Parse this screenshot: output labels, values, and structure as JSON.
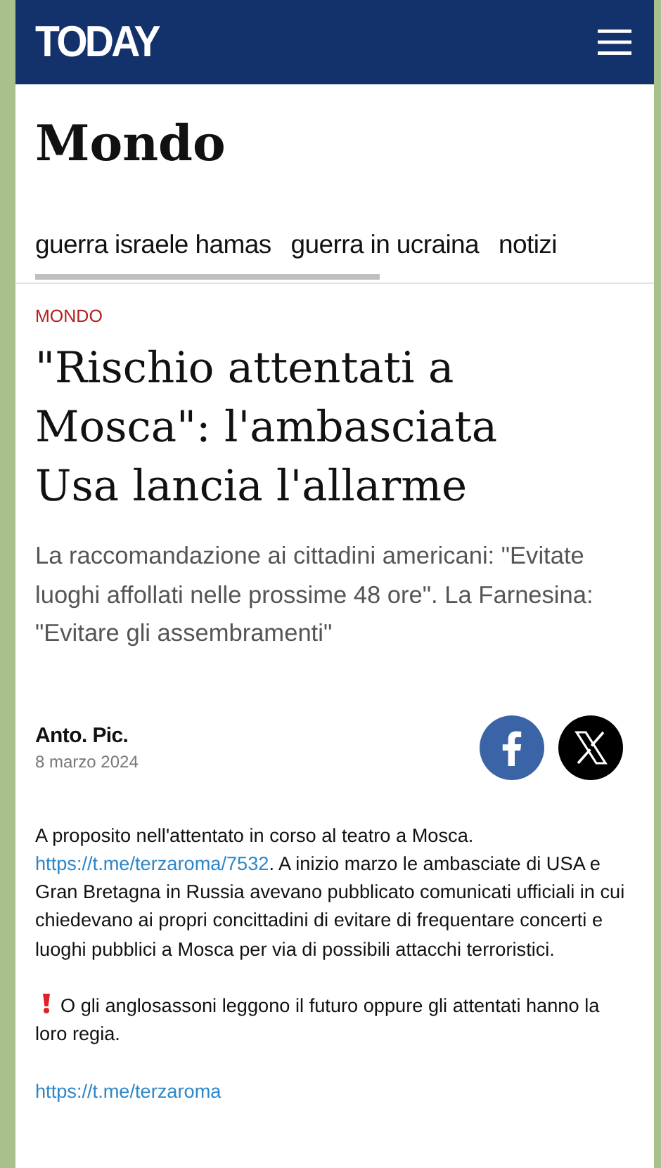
{
  "article": {
    "logo": "TODAY",
    "section_title": "Mondo",
    "tags": [
      {
        "label": "guerra israele hamas"
      },
      {
        "label": "guerra in ucraina"
      },
      {
        "label": "notizi"
      }
    ],
    "category": "MONDO",
    "headline": "\"Rischio attentati a Mosca\": l'ambasciata Usa lancia l'allarme",
    "summary": "La raccomandazione ai cittadini americani: \"Evitate luoghi affollati nelle prossime 48 ore\". La Farnesina: \"Evitare gli assembramenti\"",
    "author": "Anto. Pic.",
    "date": "8 marzo 2024",
    "share": [
      {
        "kind": "facebook"
      },
      {
        "kind": "x"
      }
    ]
  },
  "message": {
    "paragraphs": [
      {
        "kind": "plain",
        "segments": [
          {
            "kind": "text",
            "text": "A proposito nell'attentato in corso al teatro a Mosca. "
          },
          {
            "kind": "link",
            "text": "https://t.me/terzaroma/7532"
          },
          {
            "kind": "text",
            "text": ". A inizio marzo le ambasciate di USA e Gran Bretagna in Russia avevano pubblicato comunicati ufficiali in cui chiedevano ai propri concittadini di evitare di frequentare concerti e luoghi pubblici a Mosca per via di possibili attacchi terroristici."
          }
        ]
      },
      {
        "kind": "alert",
        "segments": [
          {
            "kind": "text",
            "text": "O gli anglosassoni leggono il futuro oppure gli attentati hanno la loro regia."
          }
        ]
      },
      {
        "kind": "plain",
        "segments": [
          {
            "kind": "link",
            "text": "https://t.me/terzaroma"
          }
        ]
      }
    ]
  }
}
